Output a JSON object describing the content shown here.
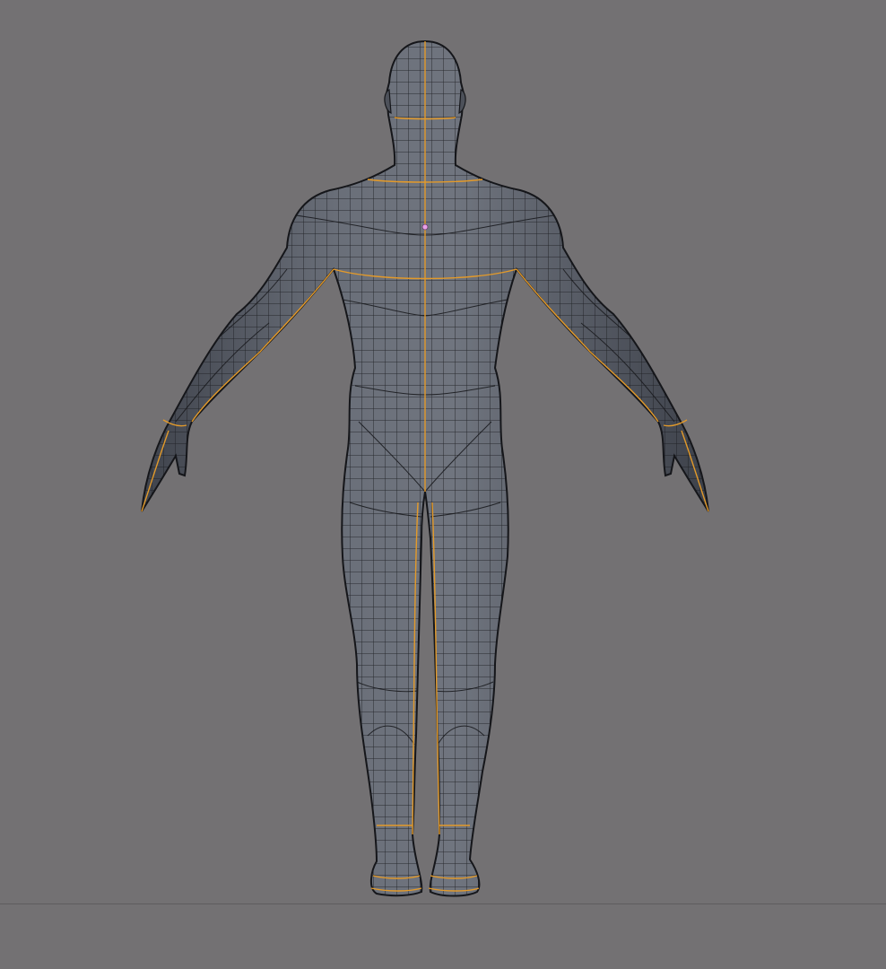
{
  "viewport": {
    "background": "#737173",
    "mesh_fill": "#5d616b",
    "edge_color": "#1b1c20",
    "seam_color": "#e39a2a",
    "origin_color": "#e8a0e8"
  }
}
